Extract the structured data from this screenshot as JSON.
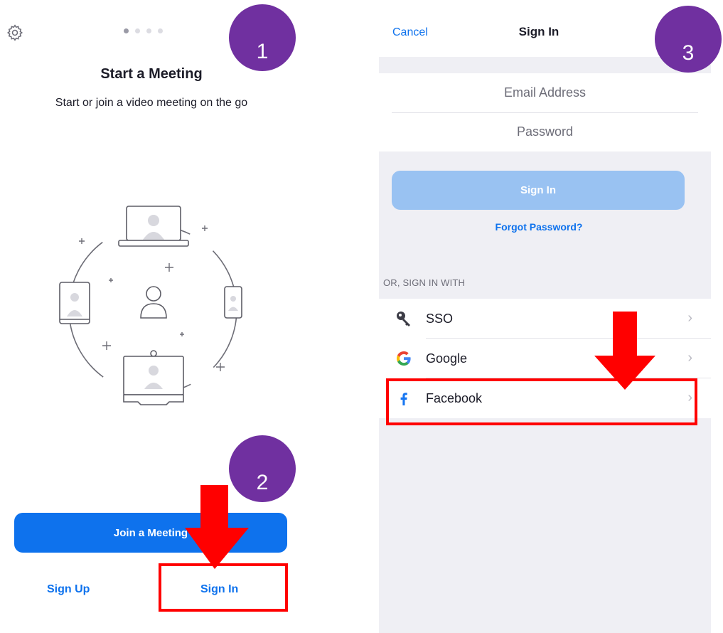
{
  "left": {
    "title": "Start a Meeting",
    "subtitle": "Start or join a video meeting on the go",
    "join_button": "Join a Meeting",
    "sign_up": "Sign Up",
    "sign_in": "Sign In",
    "page_dots": 4,
    "active_dot": 1
  },
  "right": {
    "cancel": "Cancel",
    "title": "Sign In",
    "email_placeholder": "Email Address",
    "password_placeholder": "Password",
    "signin_button": "Sign In",
    "forgot": "Forgot Password?",
    "or_label": "OR, SIGN IN WITH",
    "providers": [
      {
        "label": "SSO",
        "icon": "key-icon"
      },
      {
        "label": "Google",
        "icon": "google-icon"
      },
      {
        "label": "Facebook",
        "icon": "facebook-icon"
      }
    ]
  },
  "annotations": {
    "badge1": "1",
    "badge2": "2",
    "badge3": "3",
    "badge_color": "#7030a0",
    "highlight_color": "#ff0000"
  },
  "colors": {
    "accent": "#0e72ed",
    "disabled_button": "#99c2f2"
  }
}
